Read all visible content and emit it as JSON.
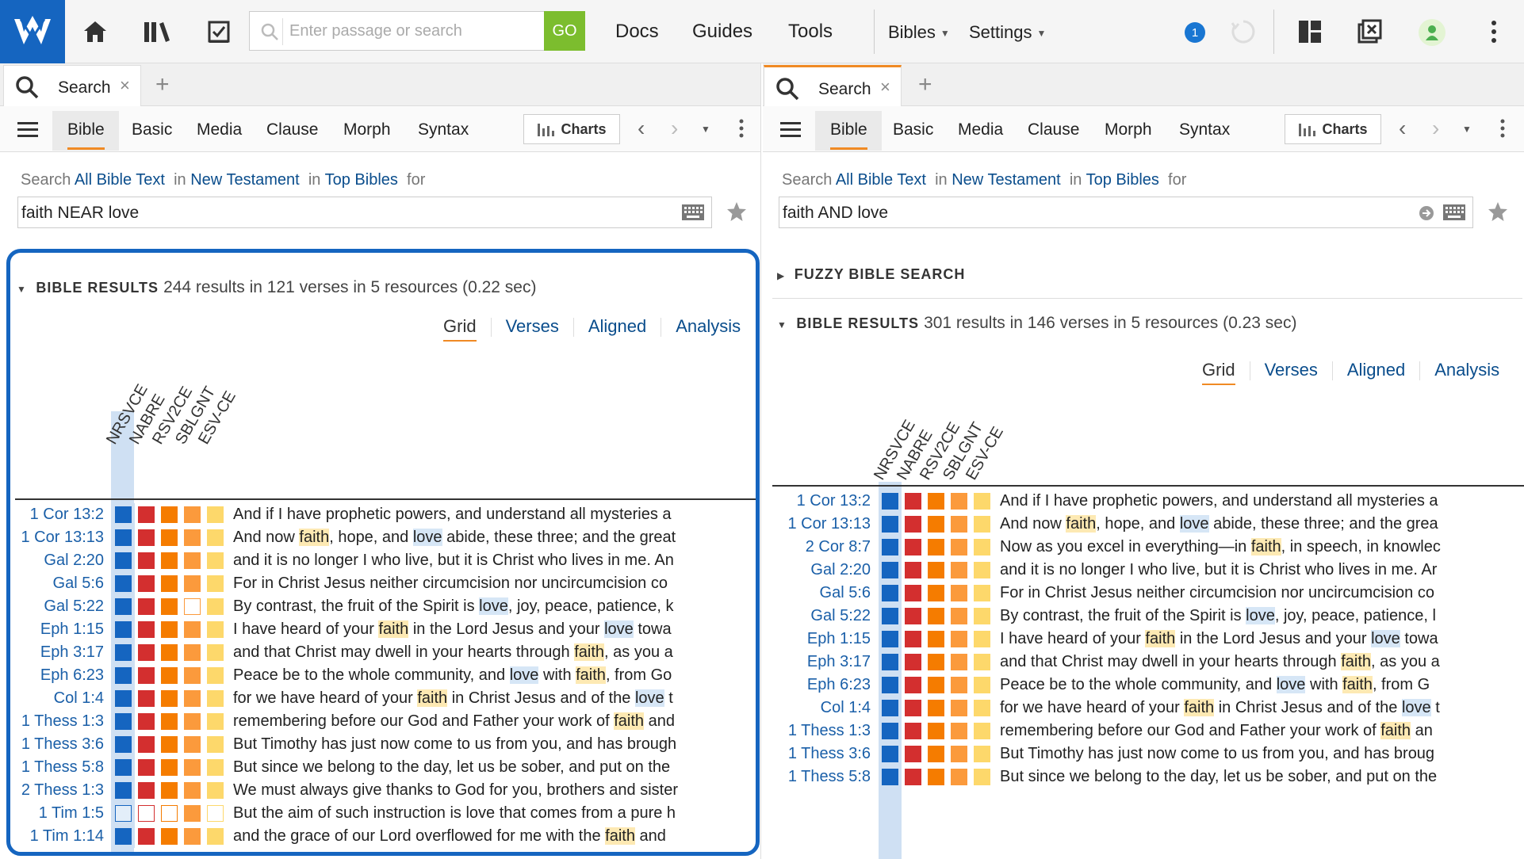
{
  "topbar": {
    "search_placeholder": "Enter passage or search",
    "go_label": "GO",
    "menus": [
      "Docs",
      "Guides",
      "Tools"
    ],
    "dropdowns": [
      "Bibles",
      "Settings"
    ],
    "notification_count": "1"
  },
  "colors": {
    "brand": "#1565c0",
    "go": "#7cbd2e",
    "accent": "#f08a24",
    "link": "#0a4d8c",
    "col_colors": [
      "#1565c0",
      "#d32f2f",
      "#f57c00",
      "#fb9a3c",
      "#fdd86b"
    ]
  },
  "left": {
    "tab_label": "Search",
    "subtabs": [
      "Bible",
      "Basic",
      "Media",
      "Clause",
      "Morph",
      "Syntax"
    ],
    "charts_label": "Charts",
    "search_prefix": "Search",
    "scope_text": "All Bible Text",
    "in1": "in",
    "range_text": "New Testament",
    "in2": "in",
    "resource_text": "Top Bibles",
    "for_text": "for",
    "query": "faith NEAR love",
    "results_title": "BIBLE RESULTS",
    "results_meta": "244 results in 121 verses in 5 resources (0.22 sec)",
    "views": [
      "Grid",
      "Verses",
      "Aligned",
      "Analysis"
    ],
    "columns": [
      "NRSVCE",
      "NABRE",
      "RSV2CE",
      "SBLGNT",
      "ESV-CE"
    ],
    "rows": [
      {
        "ref": "1 Cor 13:2",
        "hits": [
          1,
          1,
          1,
          1,
          1
        ],
        "text": [
          [
            "And if I have prophetic powers, and understand all mysteries a",
            ""
          ]
        ]
      },
      {
        "ref": "1 Cor 13:13",
        "hits": [
          1,
          1,
          1,
          1,
          1
        ],
        "text": [
          [
            "And now ",
            ""
          ],
          [
            "faith",
            "f"
          ],
          [
            ", hope, and ",
            ""
          ],
          [
            "love",
            "l"
          ],
          [
            " abide, these three; and the great",
            ""
          ]
        ]
      },
      {
        "ref": "Gal 2:20",
        "hits": [
          1,
          1,
          1,
          1,
          1
        ],
        "text": [
          [
            "and it is no longer I who live, but it is Christ who lives in me. An",
            ""
          ]
        ]
      },
      {
        "ref": "Gal 5:6",
        "hits": [
          1,
          1,
          1,
          1,
          1
        ],
        "text": [
          [
            "For in Christ Jesus neither circumcision nor uncircumcision co",
            ""
          ]
        ]
      },
      {
        "ref": "Gal 5:22",
        "hits": [
          1,
          1,
          1,
          0,
          1
        ],
        "text": [
          [
            "By contrast, the fruit of the Spirit is ",
            ""
          ],
          [
            "love",
            "l"
          ],
          [
            ", joy, peace, patience, k",
            ""
          ]
        ]
      },
      {
        "ref": "Eph 1:15",
        "hits": [
          1,
          1,
          1,
          1,
          1
        ],
        "text": [
          [
            "I have heard of your ",
            ""
          ],
          [
            "faith",
            "f"
          ],
          [
            " in the Lord Jesus and your ",
            ""
          ],
          [
            "love",
            "l"
          ],
          [
            " towa",
            ""
          ]
        ]
      },
      {
        "ref": "Eph 3:17",
        "hits": [
          1,
          1,
          1,
          1,
          1
        ],
        "text": [
          [
            "and that Christ may dwell in your hearts through ",
            ""
          ],
          [
            "faith",
            "f"
          ],
          [
            ", as you a",
            ""
          ]
        ]
      },
      {
        "ref": "Eph 6:23",
        "hits": [
          1,
          1,
          1,
          1,
          1
        ],
        "text": [
          [
            "Peace be to the whole community, and ",
            ""
          ],
          [
            "love",
            "l"
          ],
          [
            " with ",
            ""
          ],
          [
            "faith",
            "f"
          ],
          [
            ", from Go",
            ""
          ]
        ]
      },
      {
        "ref": "Col 1:4",
        "hits": [
          1,
          1,
          1,
          1,
          1
        ],
        "text": [
          [
            "for we have heard of your ",
            ""
          ],
          [
            "faith",
            "f"
          ],
          [
            " in Christ Jesus and of the ",
            ""
          ],
          [
            "love",
            "l"
          ],
          [
            " t",
            ""
          ]
        ]
      },
      {
        "ref": "1 Thess 1:3",
        "hits": [
          1,
          1,
          1,
          1,
          1
        ],
        "text": [
          [
            "remembering before our God and Father your work of ",
            ""
          ],
          [
            "faith",
            "f"
          ],
          [
            " and",
            ""
          ]
        ]
      },
      {
        "ref": "1 Thess 3:6",
        "hits": [
          1,
          1,
          1,
          1,
          1
        ],
        "text": [
          [
            "But Timothy has just now come to us from you, and has brough",
            ""
          ]
        ]
      },
      {
        "ref": "1 Thess 5:8",
        "hits": [
          1,
          1,
          1,
          1,
          1
        ],
        "text": [
          [
            "But since we belong to the day, let us be sober, and put on the",
            ""
          ]
        ]
      },
      {
        "ref": "2 Thess 1:3",
        "hits": [
          1,
          1,
          1,
          1,
          1
        ],
        "text": [
          [
            "We must always give thanks to God for you, brothers and sister",
            ""
          ]
        ]
      },
      {
        "ref": "1 Tim 1:5",
        "hits": [
          0,
          0,
          0,
          1,
          0
        ],
        "text": [
          [
            "But the aim of such instruction is love that comes from a pure h",
            ""
          ]
        ]
      },
      {
        "ref": "1 Tim 1:14",
        "hits": [
          1,
          1,
          1,
          1,
          1
        ],
        "text": [
          [
            "and the grace of our Lord overflowed for me with the ",
            ""
          ],
          [
            "faith",
            "f"
          ],
          [
            " and",
            ""
          ]
        ]
      }
    ]
  },
  "right": {
    "tab_label": "Search",
    "subtabs": [
      "Bible",
      "Basic",
      "Media",
      "Clause",
      "Morph",
      "Syntax"
    ],
    "charts_label": "Charts",
    "search_prefix": "Search",
    "scope_text": "All Bible Text",
    "in1": "in",
    "range_text": "New Testament",
    "in2": "in",
    "resource_text": "Top Bibles",
    "for_text": "for",
    "query": "faith AND love",
    "fuzzy_title": "FUZZY BIBLE SEARCH",
    "results_title": "BIBLE RESULTS",
    "results_meta": "301 results in 146 verses in 5 resources (0.23 sec)",
    "views": [
      "Grid",
      "Verses",
      "Aligned",
      "Analysis"
    ],
    "columns": [
      "NRSVCE",
      "NABRE",
      "RSV2CE",
      "SBLGNT",
      "ESV-CE"
    ],
    "rows": [
      {
        "ref": "1 Cor 13:2",
        "hits": [
          1,
          1,
          1,
          1,
          1
        ],
        "text": [
          [
            "And if I have prophetic powers, and understand all mysteries a",
            ""
          ]
        ]
      },
      {
        "ref": "1 Cor 13:13",
        "hits": [
          1,
          1,
          1,
          1,
          1
        ],
        "text": [
          [
            "And now ",
            ""
          ],
          [
            "faith",
            "f"
          ],
          [
            ", hope, and ",
            ""
          ],
          [
            "love",
            "l"
          ],
          [
            " abide, these three; and the grea",
            ""
          ]
        ]
      },
      {
        "ref": "2 Cor 8:7",
        "hits": [
          1,
          1,
          1,
          1,
          1
        ],
        "text": [
          [
            "Now as you excel in everything—in ",
            ""
          ],
          [
            "faith",
            "f"
          ],
          [
            ", in speech, in knowlec",
            ""
          ]
        ]
      },
      {
        "ref": "Gal 2:20",
        "hits": [
          1,
          1,
          1,
          1,
          1
        ],
        "text": [
          [
            "and it is no longer I who live, but it is Christ who lives in me. Ar",
            ""
          ]
        ]
      },
      {
        "ref": "Gal 5:6",
        "hits": [
          1,
          1,
          1,
          1,
          1
        ],
        "text": [
          [
            "For in Christ Jesus neither circumcision nor uncircumcision co",
            ""
          ]
        ]
      },
      {
        "ref": "Gal 5:22",
        "hits": [
          1,
          1,
          1,
          1,
          1
        ],
        "text": [
          [
            "By contrast, the fruit of the Spirit is ",
            ""
          ],
          [
            "love",
            "l"
          ],
          [
            ", joy, peace, patience, l",
            ""
          ]
        ]
      },
      {
        "ref": "Eph 1:15",
        "hits": [
          1,
          1,
          1,
          1,
          1
        ],
        "text": [
          [
            "I have heard of your ",
            ""
          ],
          [
            "faith",
            "f"
          ],
          [
            " in the Lord Jesus and your ",
            ""
          ],
          [
            "love",
            "l"
          ],
          [
            " towa",
            ""
          ]
        ]
      },
      {
        "ref": "Eph 3:17",
        "hits": [
          1,
          1,
          1,
          1,
          1
        ],
        "text": [
          [
            "and that Christ may dwell in your hearts through ",
            ""
          ],
          [
            "faith",
            "f"
          ],
          [
            ", as you a",
            ""
          ]
        ]
      },
      {
        "ref": "Eph 6:23",
        "hits": [
          1,
          1,
          1,
          1,
          1
        ],
        "text": [
          [
            "Peace be to the whole community, and ",
            ""
          ],
          [
            "love",
            "l"
          ],
          [
            " with ",
            ""
          ],
          [
            "faith",
            "f"
          ],
          [
            ", from G",
            ""
          ]
        ]
      },
      {
        "ref": "Col 1:4",
        "hits": [
          1,
          1,
          1,
          1,
          1
        ],
        "text": [
          [
            "for we have heard of your ",
            ""
          ],
          [
            "faith",
            "f"
          ],
          [
            " in Christ Jesus and of the ",
            ""
          ],
          [
            "love",
            "l"
          ],
          [
            " t",
            ""
          ]
        ]
      },
      {
        "ref": "1 Thess 1:3",
        "hits": [
          1,
          1,
          1,
          1,
          1
        ],
        "text": [
          [
            "remembering before our God and Father your work of ",
            ""
          ],
          [
            "faith",
            "f"
          ],
          [
            " an",
            ""
          ]
        ]
      },
      {
        "ref": "1 Thess 3:6",
        "hits": [
          1,
          1,
          1,
          1,
          1
        ],
        "text": [
          [
            "But Timothy has just now come to us from you, and has broug",
            ""
          ]
        ]
      },
      {
        "ref": "1 Thess 5:8",
        "hits": [
          1,
          1,
          1,
          1,
          1
        ],
        "text": [
          [
            "But since we belong to the day, let us be sober, and put on the",
            ""
          ]
        ]
      }
    ]
  }
}
